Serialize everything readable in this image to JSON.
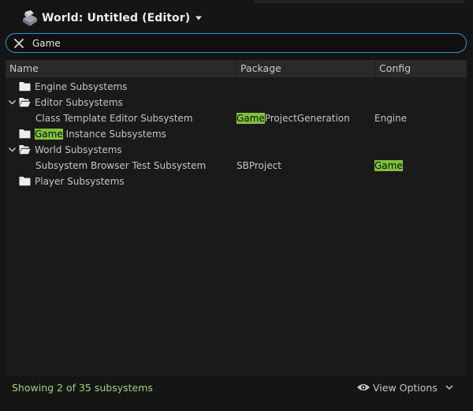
{
  "header": {
    "title": "World: Untitled (Editor)"
  },
  "search": {
    "value": "Game"
  },
  "columns": {
    "name": "Name",
    "package": "Package",
    "config": "Config"
  },
  "rows": [
    {
      "type": "category",
      "pre": "",
      "hl": "",
      "post": "Engine Subsystems",
      "expanded": false,
      "package": {
        "hl": "",
        "post": ""
      },
      "config": {
        "hl": "",
        "post": ""
      }
    },
    {
      "type": "category",
      "pre": "",
      "hl": "",
      "post": "Editor Subsystems",
      "expanded": true,
      "package": {
        "hl": "",
        "post": ""
      },
      "config": {
        "hl": "",
        "post": ""
      }
    },
    {
      "type": "item",
      "pre": "",
      "hl": "",
      "post": "Class Template Editor Subsystem",
      "package": {
        "hl": "Game",
        "post": "ProjectGeneration"
      },
      "config": {
        "hl": "",
        "post": "Engine"
      }
    },
    {
      "type": "category",
      "pre": "",
      "hl": "Game",
      "post": " Instance Subsystems",
      "expanded": false,
      "package": {
        "hl": "",
        "post": ""
      },
      "config": {
        "hl": "",
        "post": ""
      }
    },
    {
      "type": "category",
      "pre": "",
      "hl": "",
      "post": "World Subsystems",
      "expanded": true,
      "package": {
        "hl": "",
        "post": ""
      },
      "config": {
        "hl": "",
        "post": ""
      }
    },
    {
      "type": "item",
      "pre": "",
      "hl": "",
      "post": "Subsystem Browser Test Subsystem",
      "package": {
        "hl": "",
        "post": "SBProject"
      },
      "config": {
        "hl": "Game",
        "post": ""
      }
    },
    {
      "type": "category",
      "pre": "",
      "hl": "",
      "post": "Player Subsystems",
      "expanded": false,
      "package": {
        "hl": "",
        "post": ""
      },
      "config": {
        "hl": "",
        "post": ""
      }
    }
  ],
  "footer": {
    "status": "Showing 2 of 35 subsystems",
    "view_options": "View Options"
  },
  "colors": {
    "accent": "#2f95d6",
    "highlight": "#7fc23a",
    "status_text": "#9ad27a"
  }
}
